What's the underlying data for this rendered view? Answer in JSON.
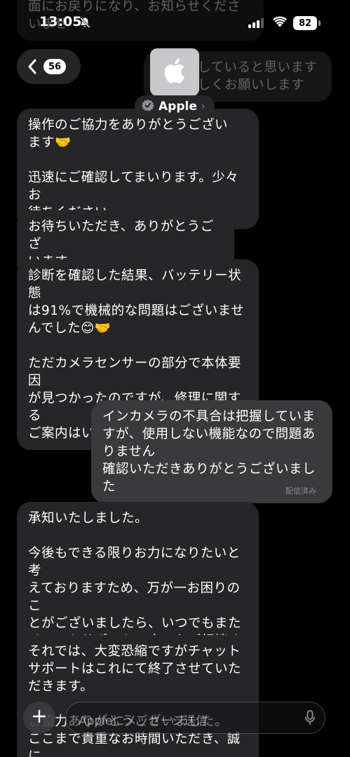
{
  "status_bar": {
    "time": "13:05",
    "battery": "82"
  },
  "header": {
    "unread_count": "56",
    "contact_name": "Apple"
  },
  "messages": [
    {
      "direction": "in",
      "text": "面にお戻りになり、お知らせくださ\nいませ"
    },
    {
      "direction": "out",
      "text": "グしていると思います\nろしくお願いします"
    },
    {
      "direction": "in",
      "text": "操作のご協力をありがとうござい\nます🤝\n\n迅速にご確認してまいります。少々お\n待ちください。"
    },
    {
      "direction": "in",
      "text": "お待ちいただき、ありがとうござ\nいます。"
    },
    {
      "direction": "in",
      "text": "診断を確認した結果、バッテリー状態\nは91%で機械的な問題はございませ\nんでした😊🤝\n\nただカメラセンサーの部分で本体要因\nが見つかったのですが、修理に関する\nご案内はいかがいたしましょうか？"
    },
    {
      "direction": "out",
      "text": "インカメラの不具合は把握していま\nすが、使用しない機能なので問題あ\nりません\n確認いただきありがとうございました"
    },
    {
      "direction": "in",
      "text": "承知いたしました。\n\n今後もできる限りお力になりたいと考\nえておりますため、万が一お困りのこ\nとがございましたら、いつでもまた\nチャットサポートの方へもご相談くだ\nさいませ。"
    },
    {
      "direction": "in",
      "text": "それでは、大変恐縮ですがチャット\nサポートはこれにて終了させていた\nだきます。\n\nご協力ありがとうございました。\nここまで貴重なお時間いただき、誠に\nありがとうございました。"
    }
  ],
  "delivered_label": "配信済み",
  "composer": {
    "placeholder": "Appleにメッセージ送信"
  },
  "icons": {
    "back": "chevron-left-icon",
    "silent": "bell-slash-icon",
    "signal": "cellular-signal-icon",
    "wifi": "wifi-icon",
    "avatar": "apple-logo-icon",
    "verified": "verified-badge-icon",
    "add": "plus-icon",
    "mic": "microphone-icon"
  },
  "colors": {
    "background": "#000000",
    "incoming_bubble": "#262628",
    "outgoing_bubble": "#3a3a3c"
  }
}
